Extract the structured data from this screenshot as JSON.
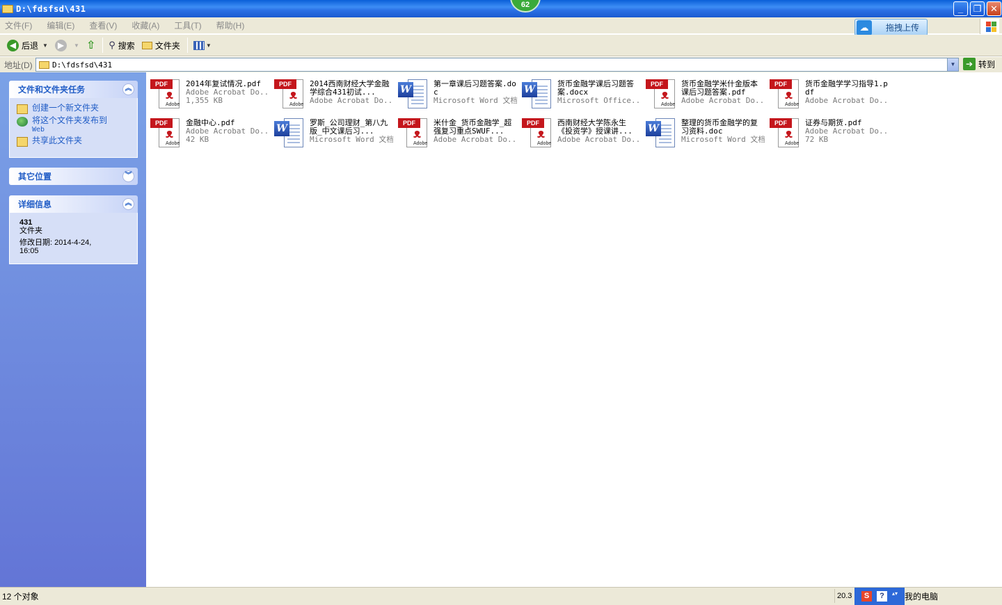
{
  "window": {
    "title": "D:\\fdsfsd\\431",
    "badge": "62"
  },
  "menu": [
    "文件(F)",
    "编辑(E)",
    "查看(V)",
    "收藏(A)",
    "工具(T)",
    "帮助(H)"
  ],
  "upload_button": "拖拽上传",
  "toolbar": {
    "back": "后退",
    "search": "搜索",
    "folders": "文件夹"
  },
  "address": {
    "label": "地址(D)",
    "value": "D:\\fdsfsd\\431",
    "go": "转到"
  },
  "tasks_panel": {
    "title": "文件和文件夹任务",
    "items": [
      {
        "label": "创建一个新文件夹",
        "sub": ""
      },
      {
        "label": "将这个文件夹发布到",
        "sub": "Web"
      },
      {
        "label": "共享此文件夹",
        "sub": ""
      }
    ]
  },
  "other_panel": {
    "title": "其它位置"
  },
  "details_panel": {
    "title": "详细信息",
    "name": "431",
    "type": "文件夹",
    "modified_line1": "修改日期: 2014-4-24,",
    "modified_line2": "16:05"
  },
  "files": [
    {
      "icon": "pdf",
      "name": "2014年复试情况.pdf",
      "type": "Adobe Acrobat Do...",
      "size": "1,355 KB"
    },
    {
      "icon": "pdf",
      "name": "2014西南财经大学金融学综合431初试...",
      "type": "Adobe Acrobat Do...",
      "size": ""
    },
    {
      "icon": "word",
      "name": "第一章课后习题答案.doc",
      "type": "Microsoft Word 文档",
      "size": ""
    },
    {
      "icon": "word",
      "name": "货币金融学课后习题答案.docx",
      "type": "Microsoft Office...",
      "size": ""
    },
    {
      "icon": "pdf",
      "name": "货币金融学米什金版本课后习题答案.pdf",
      "type": "Adobe Acrobat Do...",
      "size": ""
    },
    {
      "icon": "pdf",
      "name": "货币金融学学习指导1.pdf",
      "type": "Adobe Acrobat Do...",
      "size": ""
    },
    {
      "icon": "pdf",
      "name": "金融中心.pdf",
      "type": "Adobe Acrobat Do...",
      "size": "42 KB"
    },
    {
      "icon": "word",
      "name": "罗斯_公司理财_第八九版_中文课后习...",
      "type": "Microsoft Word 文档",
      "size": ""
    },
    {
      "icon": "pdf",
      "name": "米什金_货币金融学_超强复习重点SWUF...",
      "type": "Adobe Acrobat Do...",
      "size": ""
    },
    {
      "icon": "pdf",
      "name": "西南财经大学陈永生《投资学》授课讲...",
      "type": "Adobe Acrobat Do...",
      "size": ""
    },
    {
      "icon": "word",
      "name": "整理的货币金融学的复习资料.doc",
      "type": "Microsoft Word 文档",
      "size": ""
    },
    {
      "icon": "pdf",
      "name": "证券与期货.pdf",
      "type": "Adobe Acrobat Do...",
      "size": "72 KB"
    }
  ],
  "status": {
    "count": "12 个对象",
    "size": "20.3",
    "location": "我的电脑"
  }
}
